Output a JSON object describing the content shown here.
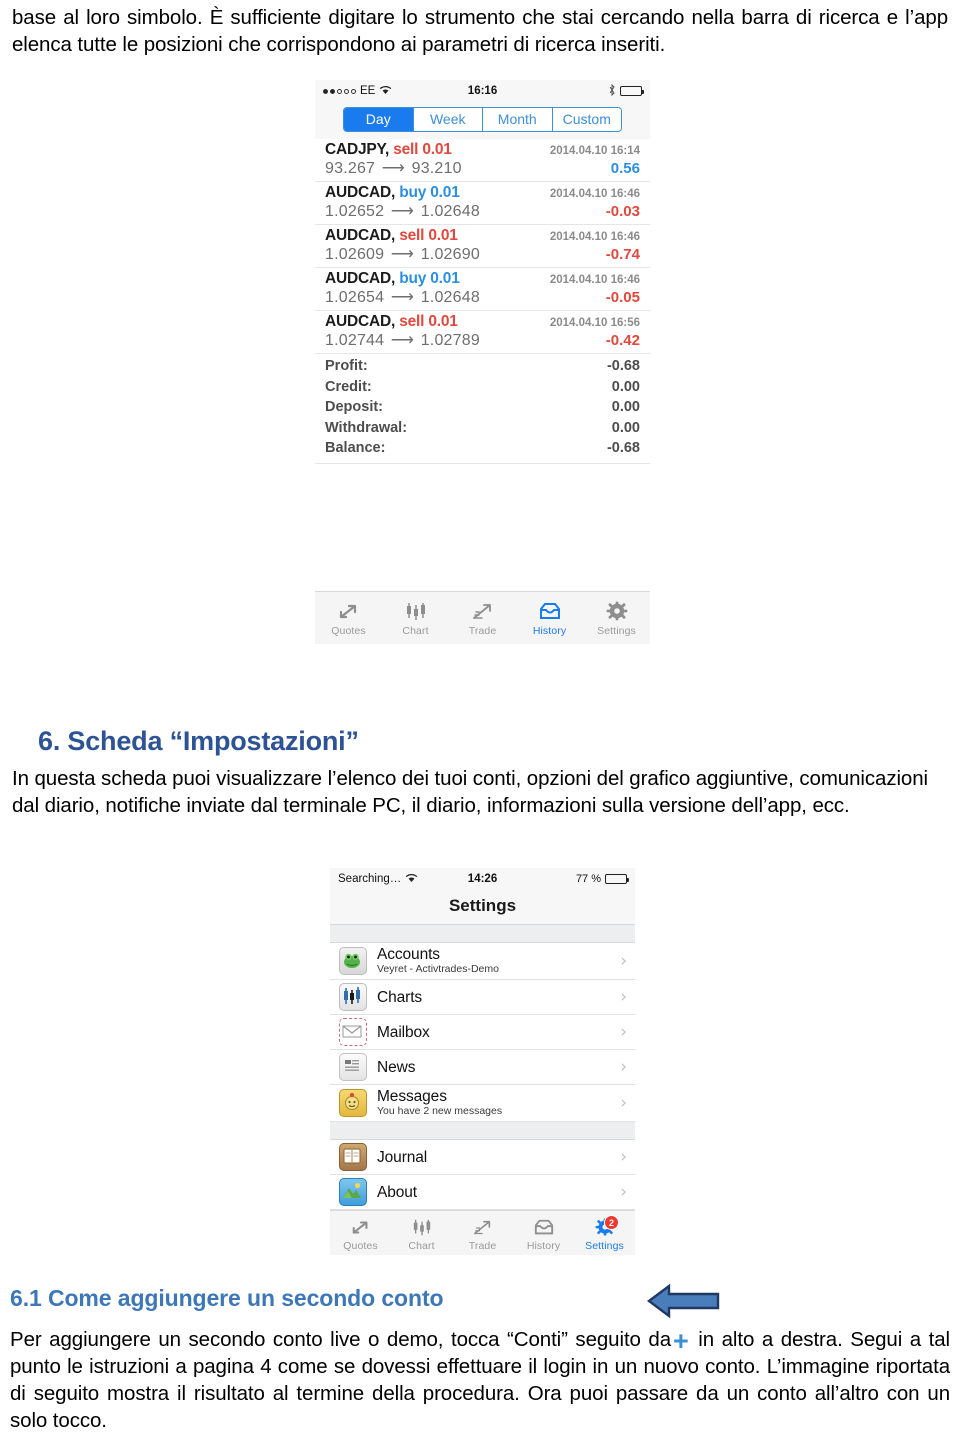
{
  "document": {
    "intro_paragraph": "base al loro simbolo. È sufficiente digitare lo strumento che stai cercando nella barra di ricerca e l’app elenca tutte le posizioni che corrispondono ai parametri di ricerca inseriti.",
    "section6_heading": "6. Scheda “Impostazioni”",
    "section6_paragraph": "In questa scheda puoi visualizzare l’elenco dei tuoi conti, opzioni del grafico aggiuntive, comunicazioni dal diario, notifiche inviate dal terminale PC, il diario, informazioni sulla versione dell’app, ecc.",
    "section61_heading": "6.1 Come aggiungere un secondo conto",
    "section61_part1": "Per aggiungere un secondo conto live o demo, tocca “Conti” seguito da",
    "section61_plus": "+",
    "section61_part2": "in alto a destra. Segui a tal punto le istruzioni a pagina 4 come se dovessi effettuare il login in un nuovo conto. L’immagine riportata di seguito mostra il risultato al termine della procedura. Ora puoi passare da un conto all’altro con un solo tocco.",
    "heading_color": "#2e5395",
    "subheading_color": "#3d77b8",
    "arrow_fill": "#4a7ebb",
    "arrow_stroke": "#1f3864"
  },
  "history_screen": {
    "statusbar": {
      "carrier": "EE",
      "signal_filled": 2,
      "signal_total": 5,
      "time": "16:16",
      "bluetooth": true,
      "battery_pct": 92
    },
    "segmented": {
      "options": [
        "Day",
        "Week",
        "Month",
        "Custom"
      ],
      "selected": "Day",
      "accent": "#1a7bef"
    },
    "trades": [
      {
        "symbol": "CADJPY,",
        "side": "sell 0.01",
        "side_type": "sell",
        "time": "2014.04.10 16:14",
        "open": "93.267",
        "close": "93.210",
        "pl": "0.56",
        "pl_type": "positive"
      },
      {
        "symbol": "AUDCAD,",
        "side": "buy 0.01",
        "side_type": "buy",
        "time": "2014.04.10 16:46",
        "open": "1.02652",
        "close": "1.02648",
        "pl": "-0.03",
        "pl_type": "negative"
      },
      {
        "symbol": "AUDCAD,",
        "side": "sell 0.01",
        "side_type": "sell",
        "time": "2014.04.10 16:46",
        "open": "1.02609",
        "close": "1.02690",
        "pl": "-0.74",
        "pl_type": "negative"
      },
      {
        "symbol": "AUDCAD,",
        "side": "buy 0.01",
        "side_type": "buy",
        "time": "2014.04.10 16:46",
        "open": "1.02654",
        "close": "1.02648",
        "pl": "-0.05",
        "pl_type": "negative"
      },
      {
        "symbol": "AUDCAD,",
        "side": "sell 0.01",
        "side_type": "sell",
        "time": "2014.04.10 16:56",
        "open": "1.02744",
        "close": "1.02789",
        "pl": "-0.42",
        "pl_type": "negative"
      }
    ],
    "summary": [
      {
        "label": "Profit:",
        "value": "-0.68"
      },
      {
        "label": "Credit:",
        "value": "0.00"
      },
      {
        "label": "Deposit:",
        "value": "0.00"
      },
      {
        "label": "Withdrawal:",
        "value": "0.00"
      },
      {
        "label": "Balance:",
        "value": "-0.68"
      }
    ],
    "tabbar": {
      "tabs": [
        {
          "label": "Quotes",
          "icon": "quotes-icon",
          "active": false
        },
        {
          "label": "Chart",
          "icon": "candlestick-icon",
          "active": false
        },
        {
          "label": "Trade",
          "icon": "trade-icon",
          "active": false
        },
        {
          "label": "History",
          "icon": "history-icon",
          "active": true
        },
        {
          "label": "Settings",
          "icon": "gear-icon",
          "active": false
        }
      ]
    }
  },
  "settings_screen": {
    "statusbar": {
      "carrier": "Searching…",
      "time": "14:26",
      "battery_text": "77 %",
      "battery_pct": 77
    },
    "nav_title": "Settings",
    "group1": [
      {
        "title": "Accounts",
        "subtitle": "Veyret - Activtrades-Demo",
        "icon": "accounts-icon",
        "chevron": "›"
      },
      {
        "title": "Charts",
        "subtitle": "",
        "icon": "charts-icon",
        "chevron": "›"
      },
      {
        "title": "Mailbox",
        "subtitle": "",
        "icon": "mailbox-icon",
        "chevron": "›"
      },
      {
        "title": "News",
        "subtitle": "",
        "icon": "news-icon",
        "chevron": "›"
      },
      {
        "title": "Messages",
        "subtitle": "You have 2 new messages",
        "icon": "messages-icon",
        "chevron": "›"
      }
    ],
    "group2": [
      {
        "title": "Journal",
        "subtitle": "",
        "icon": "journal-icon",
        "chevron": "›"
      },
      {
        "title": "About",
        "subtitle": "",
        "icon": "about-icon",
        "chevron": "›"
      }
    ],
    "tabbar": {
      "tabs": [
        {
          "label": "Quotes",
          "icon": "quotes-icon",
          "active": false,
          "badge": ""
        },
        {
          "label": "Chart",
          "icon": "candlestick-icon",
          "active": false,
          "badge": ""
        },
        {
          "label": "Trade",
          "icon": "trade-icon",
          "active": false,
          "badge": ""
        },
        {
          "label": "History",
          "icon": "history-icon",
          "active": false,
          "badge": ""
        },
        {
          "label": "Settings",
          "icon": "gear-icon",
          "active": true,
          "badge": "2"
        }
      ],
      "badge_color": "#ec3b2e"
    }
  }
}
